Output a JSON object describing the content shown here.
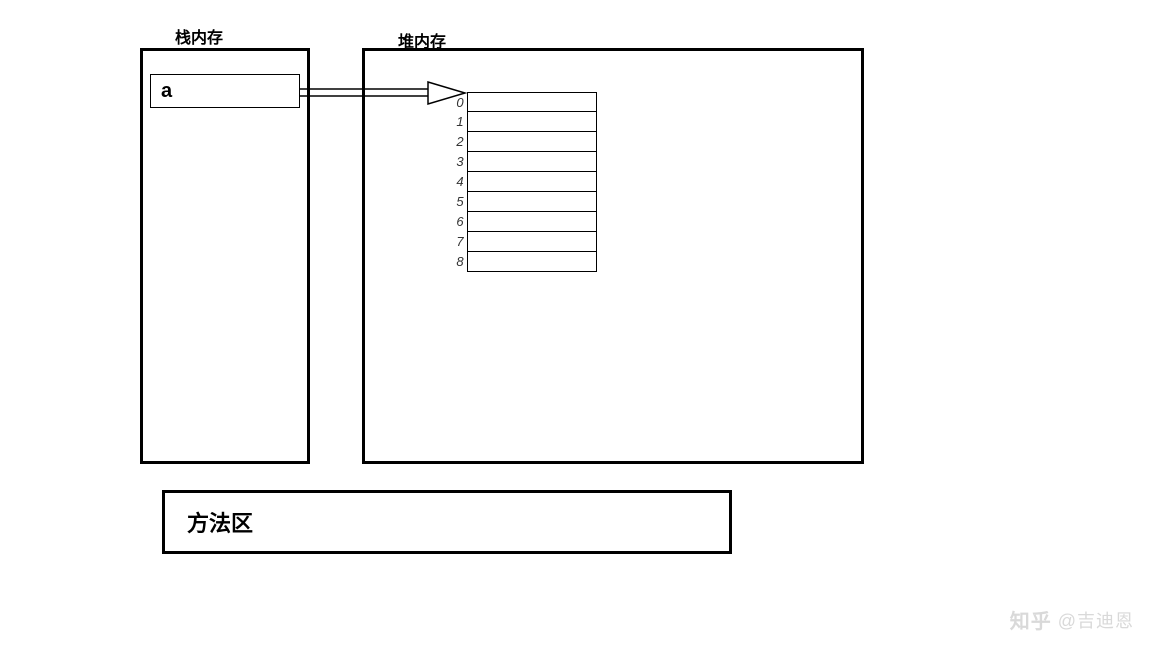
{
  "stack": {
    "title": "栈内存",
    "variable": "a"
  },
  "heap": {
    "title": "堆内存",
    "array_indices": [
      "0",
      "1",
      "2",
      "3",
      "4",
      "5",
      "6",
      "7",
      "8"
    ]
  },
  "method_area": {
    "title": "方法区"
  },
  "watermark": {
    "logo": "知乎",
    "author": "@吉迪恩"
  }
}
